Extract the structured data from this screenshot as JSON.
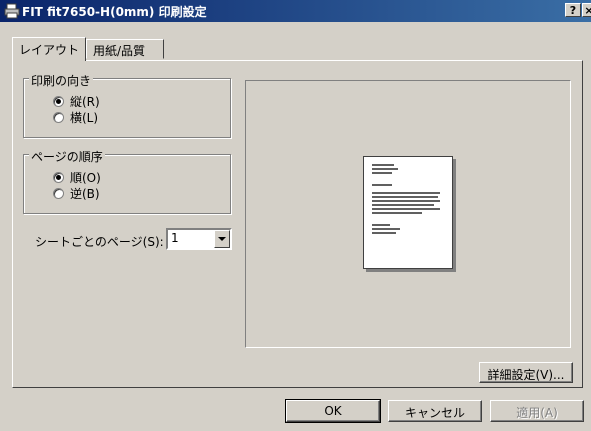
{
  "window": {
    "title": "FIT fit7650-H(0mm) 印刷設定",
    "help_button": "?",
    "close_button": "×"
  },
  "tabs": [
    {
      "label": "レイアウト",
      "active": true
    },
    {
      "label": "用紙/品質",
      "active": false
    }
  ],
  "orientation": {
    "group_label": "印刷の向き",
    "options": [
      {
        "label": "縦(R)",
        "checked": true
      },
      {
        "label": "横(L)",
        "checked": false
      }
    ]
  },
  "page_order": {
    "group_label": "ページの順序",
    "options": [
      {
        "label": "順(O)",
        "checked": true
      },
      {
        "label": "逆(B)",
        "checked": false
      }
    ]
  },
  "pages_per_sheet": {
    "label": "シートごとのページ(S):",
    "value": "1"
  },
  "buttons": {
    "advanced": "詳細設定(V)...",
    "ok": "OK",
    "cancel": "キャンセル",
    "apply": "適用(A)"
  }
}
